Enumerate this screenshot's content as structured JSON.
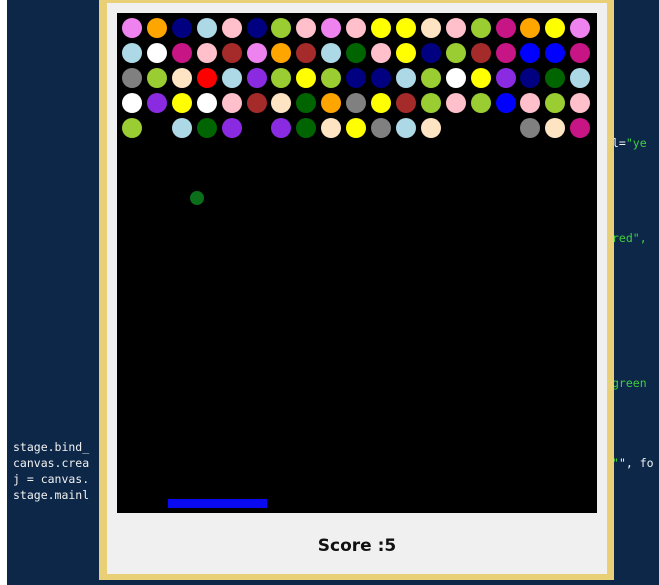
{
  "editor": {
    "left_lines": [
      "stage.bind_",
      "canvas.crea",
      "j = canvas.",
      "stage.mainl"
    ],
    "right_fragments": [
      {
        "prefix": "l=",
        "str": "\"ye"
      },
      {
        "prefix": "",
        "str": "red\","
      },
      {
        "prefix": "",
        "str": "green"
      },
      {
        "prefix": "\", fo",
        "str": ""
      }
    ]
  },
  "game": {
    "score_label": "Score :",
    "score_value": "5",
    "grid": {
      "rows": 5,
      "cols": 19
    },
    "bricks": [
      [
        "violet",
        "orange",
        "navy",
        "lightblue",
        "pink",
        "navy",
        "yellowgreen",
        "pink",
        "violet",
        "pink",
        "yellow",
        "yellow",
        "bisque",
        "pink",
        "yellowgreen",
        "mediumvioletred",
        "orange",
        "yellow",
        "violet"
      ],
      [
        "lightblue",
        "white",
        "mediumvioletred",
        "pink",
        "brown",
        "violet",
        "orange",
        "brown",
        "lightblue",
        "green",
        "pink",
        "yellow",
        "navy",
        "yellowgreen",
        "brown",
        "mediumvioletred",
        "blue",
        "blue",
        "mediumvioletred"
      ],
      [
        "gray",
        "yellowgreen",
        "bisque",
        "red",
        "lightblue",
        "blueviolet",
        "yellowgreen",
        "yellow",
        "yellowgreen",
        "navy",
        "navy",
        "lightblue",
        "yellowgreen",
        "white",
        "yellow",
        "blueviolet",
        "navy",
        "green",
        "lightblue"
      ],
      [
        "white",
        "blueviolet",
        "yellow",
        "white",
        "pink",
        "brown",
        "bisque",
        "green",
        "orange",
        "gray",
        "yellow",
        "brown",
        "yellowgreen",
        "pink",
        "yellowgreen",
        "blue",
        "pink",
        "yellowgreen",
        "pink"
      ],
      [
        "yellowgreen",
        "",
        "lightblue",
        "green",
        "blueviolet",
        "",
        "blueviolet",
        "green",
        "bisque",
        "yellow",
        "gray",
        "lightblue",
        "bisque",
        "",
        "",
        "",
        "gray",
        "bisque",
        "mediumvioletred"
      ]
    ],
    "colors": {
      "violet": "#ee82ee",
      "orange": "#ffa500",
      "navy": "#000080",
      "lightblue": "#add8e6",
      "pink": "#ffc0cb",
      "yellowgreen": "#9acd32",
      "yellow": "#ffff00",
      "bisque": "#ffe4c4",
      "mediumvioletred": "#c71585",
      "white": "#ffffff",
      "brown": "#a52a2a",
      "green": "#006400",
      "blue": "#0000ff",
      "gray": "#808080",
      "red": "#ff0000",
      "blueviolet": "#8a2be2"
    }
  }
}
